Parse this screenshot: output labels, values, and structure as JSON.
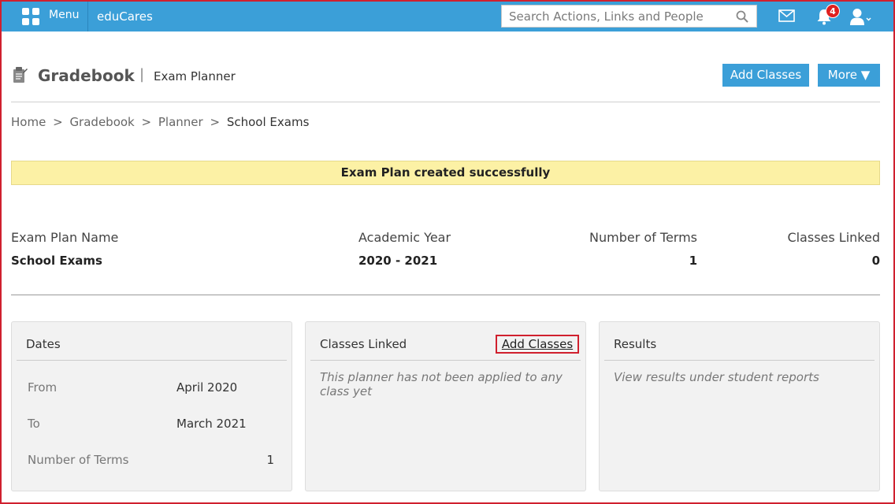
{
  "topbar": {
    "menu_label": "Menu",
    "brand": "eduCares",
    "search_placeholder": "Search Actions, Links and People",
    "notification_count": "4"
  },
  "header": {
    "title": "Gradebook",
    "separator": "|",
    "subtitle": "Exam Planner",
    "add_classes_label": "Add Classes",
    "more_label": "More ▼"
  },
  "breadcrumb": {
    "items": [
      "Home",
      "Gradebook",
      "Planner"
    ],
    "separator": ">",
    "current": "School Exams"
  },
  "alert": {
    "message": "Exam Plan created successfully"
  },
  "summary": {
    "exam_plan_name_label": "Exam Plan Name",
    "exam_plan_name_value": "School Exams",
    "academic_year_label": "Academic Year",
    "academic_year_value": "2020 - 2021",
    "terms_label": "Number of Terms",
    "terms_value": "1",
    "classes_label": "Classes Linked",
    "classes_value": "0"
  },
  "cards": {
    "dates": {
      "title": "Dates",
      "rows": [
        {
          "label": "From",
          "value": "April 2020"
        },
        {
          "label": "To",
          "value": "March 2021"
        },
        {
          "label": "Number of Terms",
          "value": "1"
        }
      ]
    },
    "classes": {
      "title": "Classes Linked",
      "link_label": "Add Classes",
      "empty_text": "This planner has not been applied to any class yet"
    },
    "results": {
      "title": "Results",
      "note": "View results under student reports"
    }
  },
  "colors": {
    "topbar": "#3b9fd8",
    "alert_bg": "#fcf1a5",
    "highlight": "#d0202e"
  }
}
